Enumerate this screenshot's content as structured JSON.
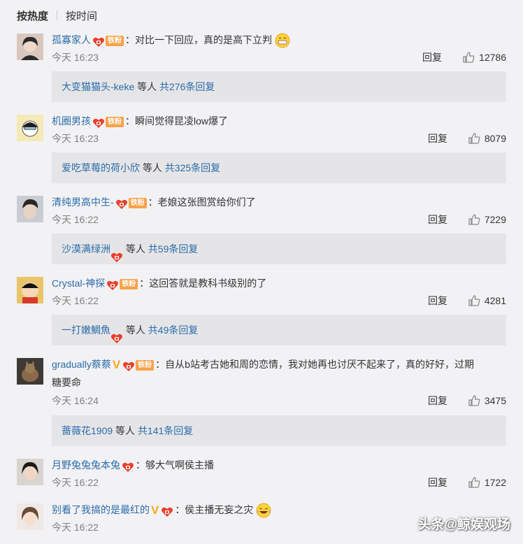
{
  "sort": {
    "hot": "按热度",
    "time": "按时间"
  },
  "comments": [
    {
      "user": "孤寡家人",
      "fan_label": "铁粉",
      "text": "：对比一下回应，真的是高下立判",
      "time": "今天 16:23",
      "reply": "回复",
      "likes": "12786",
      "replies": {
        "user": "大变猫猫头-keke",
        "etc": " 等人 ",
        "count": "共276条回复"
      }
    },
    {
      "user": "机圈男孩",
      "fan_label": "铁粉",
      "text": "：瞬间觉得昆凌low爆了",
      "time": "今天 16:23",
      "reply": "回复",
      "likes": "8079",
      "replies": {
        "user": "爱吃草莓的荷小欣",
        "etc": " 等人 ",
        "count": "共325条回复"
      }
    },
    {
      "user": "清纯男高中生-",
      "fan_label": "铁粉",
      "text": "：老娘这张图赏给你们了",
      "time": "今天 16:22",
      "reply": "回复",
      "likes": "7229",
      "replies": {
        "user": "沙漠满绿洲",
        "etc": " 等人 ",
        "count": "共59条回复"
      }
    },
    {
      "user": "Crystal-神探",
      "fan_label": "铁粉",
      "text": "：这回答就是教科书级别的了",
      "time": "今天 16:22",
      "reply": "回复",
      "likes": "4281",
      "replies": {
        "user": "一打嫩鯛魚",
        "etc": " 等人 ",
        "count": "共49条回复"
      }
    },
    {
      "user": "gradually蔡蔡",
      "fan_label": "铁粉",
      "text": "：自从b站考古她和周的恋情，我对她再也讨厌不起来了，真的好好，过期",
      "text2": "糖要命",
      "time": "今天 16:24",
      "reply": "回复",
      "likes": "3475",
      "replies": {
        "user": "蔷薇花1909",
        "etc": " 等人 ",
        "count": "共141条回复"
      }
    },
    {
      "user": "月野兔兔兔本兔",
      "text": "：够大气啊侯主播",
      "time": "今天 16:22",
      "reply": "回复",
      "likes": "1722"
    },
    {
      "user": "别看了我搞的是最红的",
      "text": "：侯主播无妄之灾",
      "time": "今天 16:22"
    }
  ],
  "watermark": "头条@鲸娱观场",
  "colors": {
    "username": "#eb7350",
    "link": "#2b6ca8",
    "fan_badge": "#f7a24a",
    "v_badge": "#f7a81b"
  }
}
